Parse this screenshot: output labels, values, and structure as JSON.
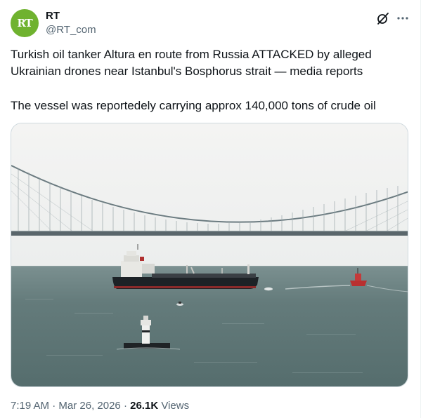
{
  "author": {
    "name": "RT",
    "handle": "@RT_com",
    "avatar_text": "RT"
  },
  "post": {
    "text_line1": "Turkish oil tanker Altura en route from Russia ATTACKED by alleged Ukrainian drones near Istanbul's Bosphorus strait — media reports",
    "text_line2": "The vessel was reportedely carrying approx 140,000 tons of crude oil"
  },
  "meta": {
    "time": "7:19 AM",
    "separator1": "·",
    "date": "Mar 26, 2026",
    "separator2": "·",
    "views_count": "26.1K",
    "views_label": "Views"
  },
  "icons": {
    "grok": "grok-icon",
    "more": "more-icon"
  },
  "colors": {
    "avatar_bg": "#6fb22f",
    "text_primary": "#0f1419",
    "text_secondary": "#536471",
    "sea": "#5e7677"
  }
}
